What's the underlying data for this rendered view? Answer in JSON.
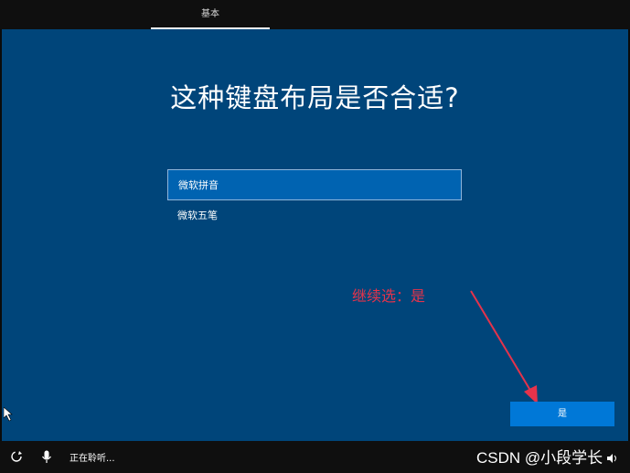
{
  "header": {
    "tab_label": "基本"
  },
  "main": {
    "title": "这种键盘布局是否合适?",
    "layouts": [
      "微软拼音",
      "微软五笔"
    ],
    "selected_index": 0
  },
  "annotation": {
    "text": "继续选：是",
    "color": "#e5334b"
  },
  "footer": {
    "yes_label": "是",
    "listening_text": "正在聆听...",
    "watermark": "CSDN @小段学长"
  },
  "icons": [
    "accessibility-icon",
    "microphone-icon",
    "volume-icon"
  ],
  "colors": {
    "background": "#00457a",
    "selected_item": "#0063b1",
    "primary_button": "#0078d7",
    "bars": "#0f0f0f"
  }
}
